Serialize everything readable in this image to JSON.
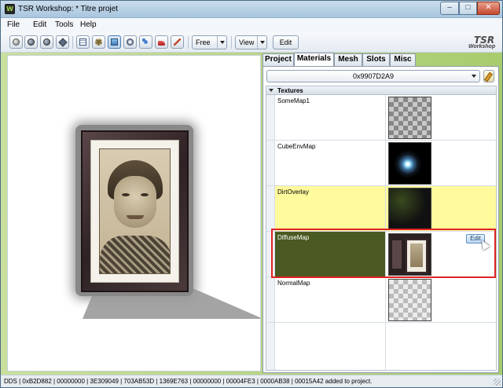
{
  "window": {
    "title": "TSR Workshop: * Titre projet",
    "controls": {
      "minimize": "–",
      "maximize": "□",
      "close": "✕"
    }
  },
  "menu": {
    "items": [
      "File",
      "Edit",
      "Tools",
      "Help"
    ]
  },
  "toolbar": {
    "icons": [
      "sphere-icon",
      "sphere-icon",
      "sphere-icon",
      "diamond-icon",
      "grid-icon",
      "gear-icon",
      "image-icon",
      "dot-icon",
      "molecule-icon",
      "shoe-icon",
      "brush-icon"
    ],
    "camera_mode": "Free",
    "view_label": "View",
    "edit_label": "Edit"
  },
  "logo": {
    "big": "TSR",
    "small": "Workshop"
  },
  "tabs": [
    "Project",
    "Materials",
    "Mesh",
    "Slots",
    "Misc"
  ],
  "active_tab": "Materials",
  "material_selector": {
    "value": "0x9907D2A9"
  },
  "textures": {
    "category": "Textures",
    "rows": [
      {
        "name": "SomeMap1",
        "thumb": "checker"
      },
      {
        "name": "CubeEnvMap",
        "thumb": "cubemap"
      },
      {
        "name": "DirtOverlay",
        "thumb": "dirt"
      },
      {
        "name": "DiffuseMap",
        "thumb": "diffuse"
      },
      {
        "name": "NormalMap",
        "thumb": "checker-light"
      }
    ],
    "edit_button": "Edit"
  },
  "status": {
    "text": "DDS | 0xB2D882 | 00000000 | 3E309049 | 703AB53D | 1369E763 | 00000000 | 00004FE3 | 0000AB38 | 00015A42 added to project."
  },
  "colors": {
    "accent_green": "#a8cc6e",
    "selected_row": "#4a5a22",
    "highlight_row": "#fffa9c",
    "highlight_box": "#e02222"
  }
}
